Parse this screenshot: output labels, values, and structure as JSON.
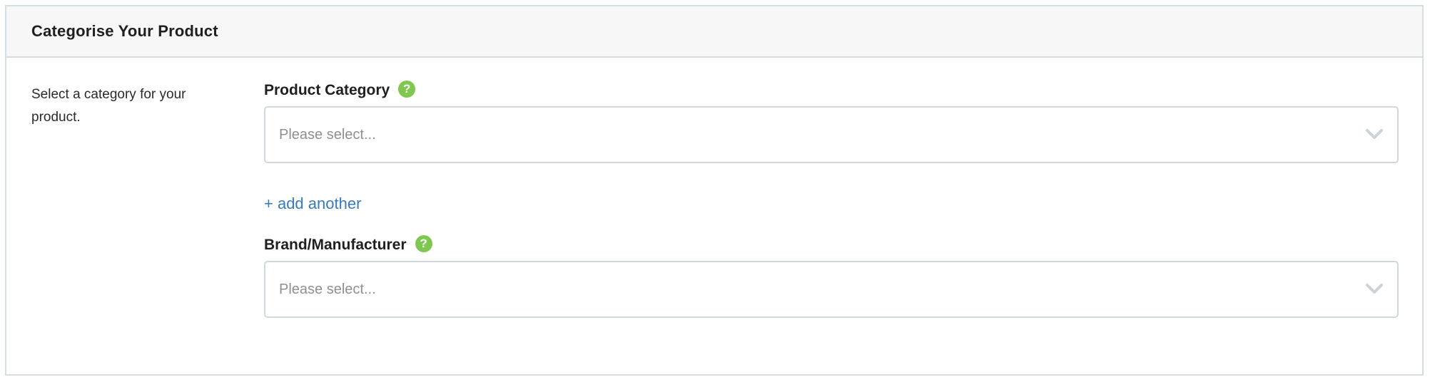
{
  "panel": {
    "title": "Categorise Your Product",
    "description": "Select a category for your product."
  },
  "fields": {
    "product_category": {
      "label": "Product Category",
      "help_icon": "question-mark",
      "selected_value": "Please select..."
    },
    "add_another": {
      "label": "+ add another"
    },
    "brand_manufacturer": {
      "label": "Brand/Manufacturer",
      "help_icon": "question-mark",
      "selected_value": "Please select..."
    }
  },
  "colors": {
    "help_icon": "#7ec850",
    "link": "#3a7ab8",
    "placeholder": "#8f8f8f",
    "border": "#cfd8dc",
    "header_bg": "#f7f7f7"
  }
}
